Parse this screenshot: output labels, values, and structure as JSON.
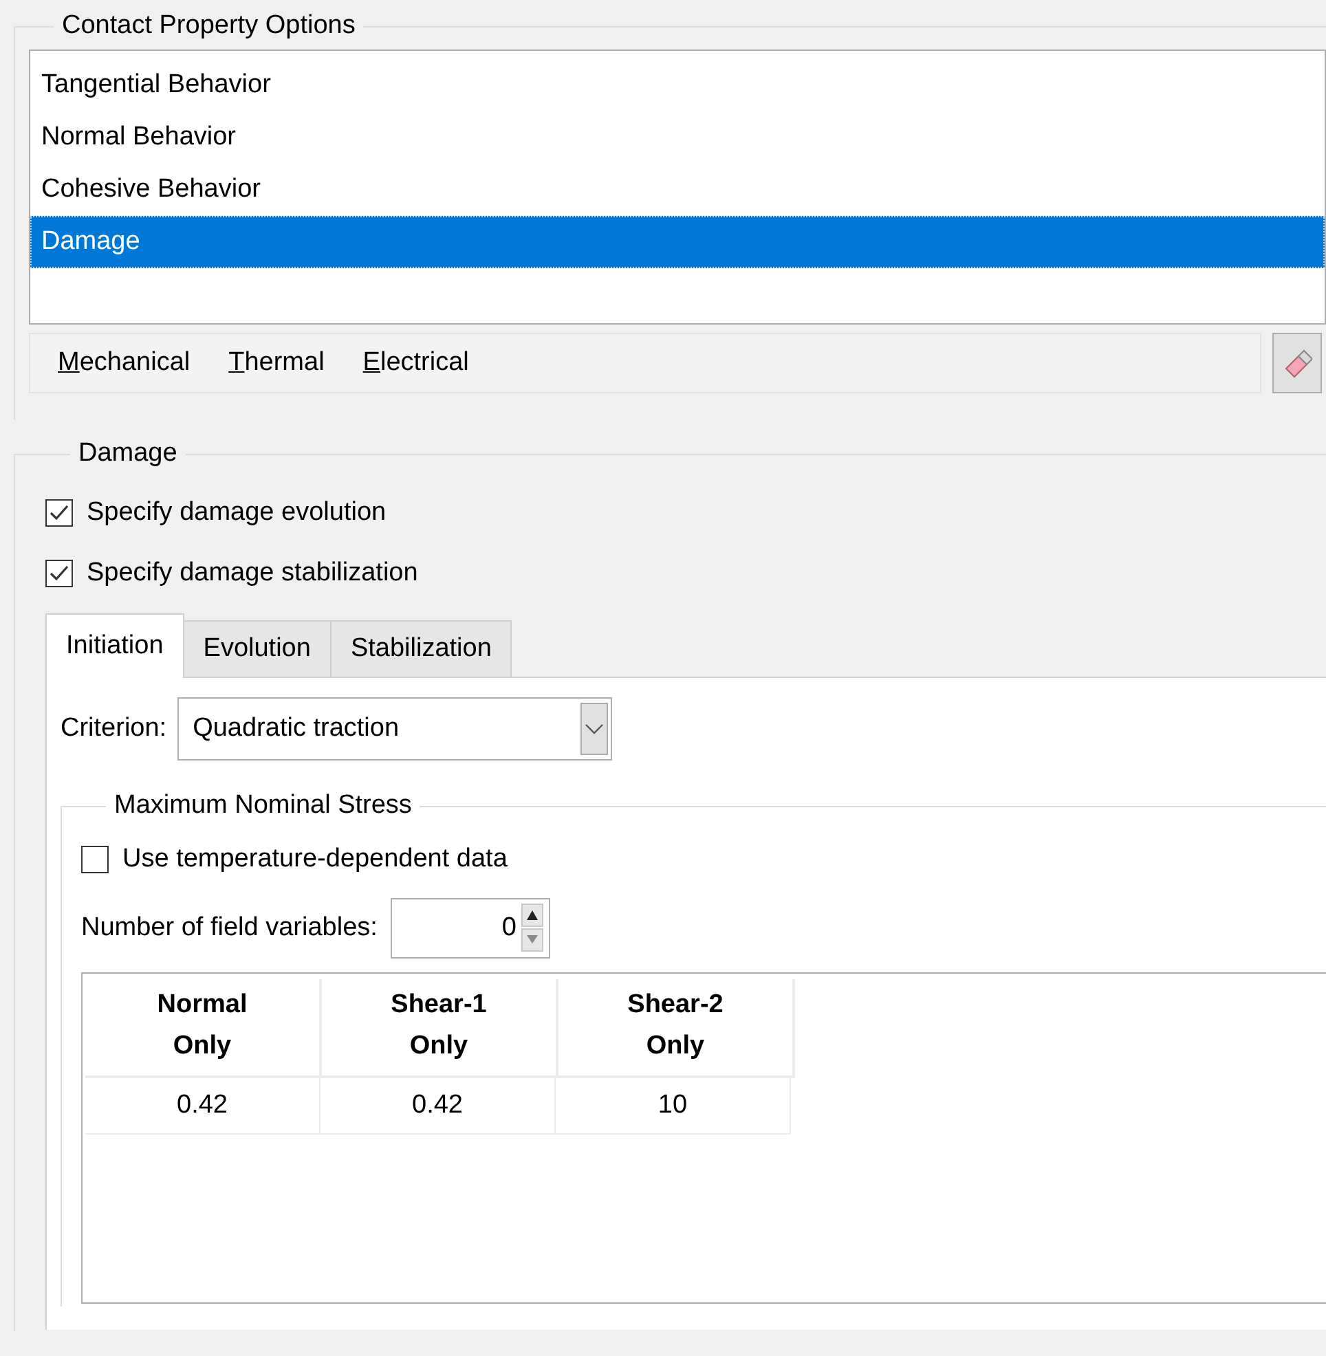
{
  "contact_property_options": {
    "title": "Contact Property Options",
    "items": [
      {
        "label": "Tangential Behavior",
        "selected": false
      },
      {
        "label": "Normal Behavior",
        "selected": false
      },
      {
        "label": "Cohesive Behavior",
        "selected": false
      },
      {
        "label": "Damage",
        "selected": true
      }
    ],
    "menu": [
      {
        "mnemonic": "M",
        "rest": "echanical"
      },
      {
        "mnemonic": "T",
        "rest": "hermal"
      },
      {
        "mnemonic": "E",
        "rest": "lectrical"
      }
    ]
  },
  "damage": {
    "title": "Damage",
    "checkboxes": [
      {
        "label": "Specify damage evolution",
        "checked": true
      },
      {
        "label": "Specify damage stabilization",
        "checked": true
      }
    ],
    "tabs": [
      {
        "label": "Initiation",
        "selected": true
      },
      {
        "label": "Evolution",
        "selected": false
      },
      {
        "label": "Stabilization",
        "selected": false
      }
    ],
    "criterion": {
      "label": "Criterion:",
      "value": "Quadratic traction"
    },
    "maximum_nominal_stress": {
      "title": "Maximum Nominal Stress",
      "checkbox": {
        "label": "Use temperature-dependent data",
        "checked": false
      },
      "field_variables": {
        "label": "Number of field variables:",
        "value": "0"
      },
      "table": {
        "columns": [
          "Normal\nOnly",
          "Shear-1\nOnly",
          "Shear-2\nOnly"
        ],
        "rows": [
          [
            "0.42",
            "0.42",
            "10"
          ]
        ]
      }
    }
  }
}
